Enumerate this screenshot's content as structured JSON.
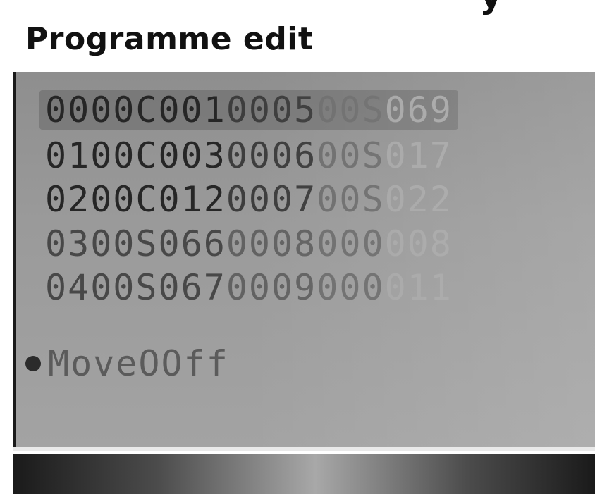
{
  "header": {
    "cut_text": "y",
    "title": "Programme edit"
  },
  "program_list": {
    "rows": [
      {
        "a": "0000C001",
        "b": "0005",
        "c": "00S",
        "d": "069",
        "selected": true
      },
      {
        "a": "0100C003",
        "b": "0006",
        "c": "00S",
        "d": "017",
        "selected": false
      },
      {
        "a": "0200C012",
        "b": "0007",
        "c": "00S",
        "d": "022",
        "selected": false
      },
      {
        "a": "0300S066",
        "b": "0008",
        "c": "000",
        "d": "008",
        "selected": false
      },
      {
        "a": "0400S067",
        "b": "0009",
        "c": "000",
        "d": "011",
        "selected": false
      }
    ]
  },
  "move": {
    "label": "MoveOOff"
  }
}
